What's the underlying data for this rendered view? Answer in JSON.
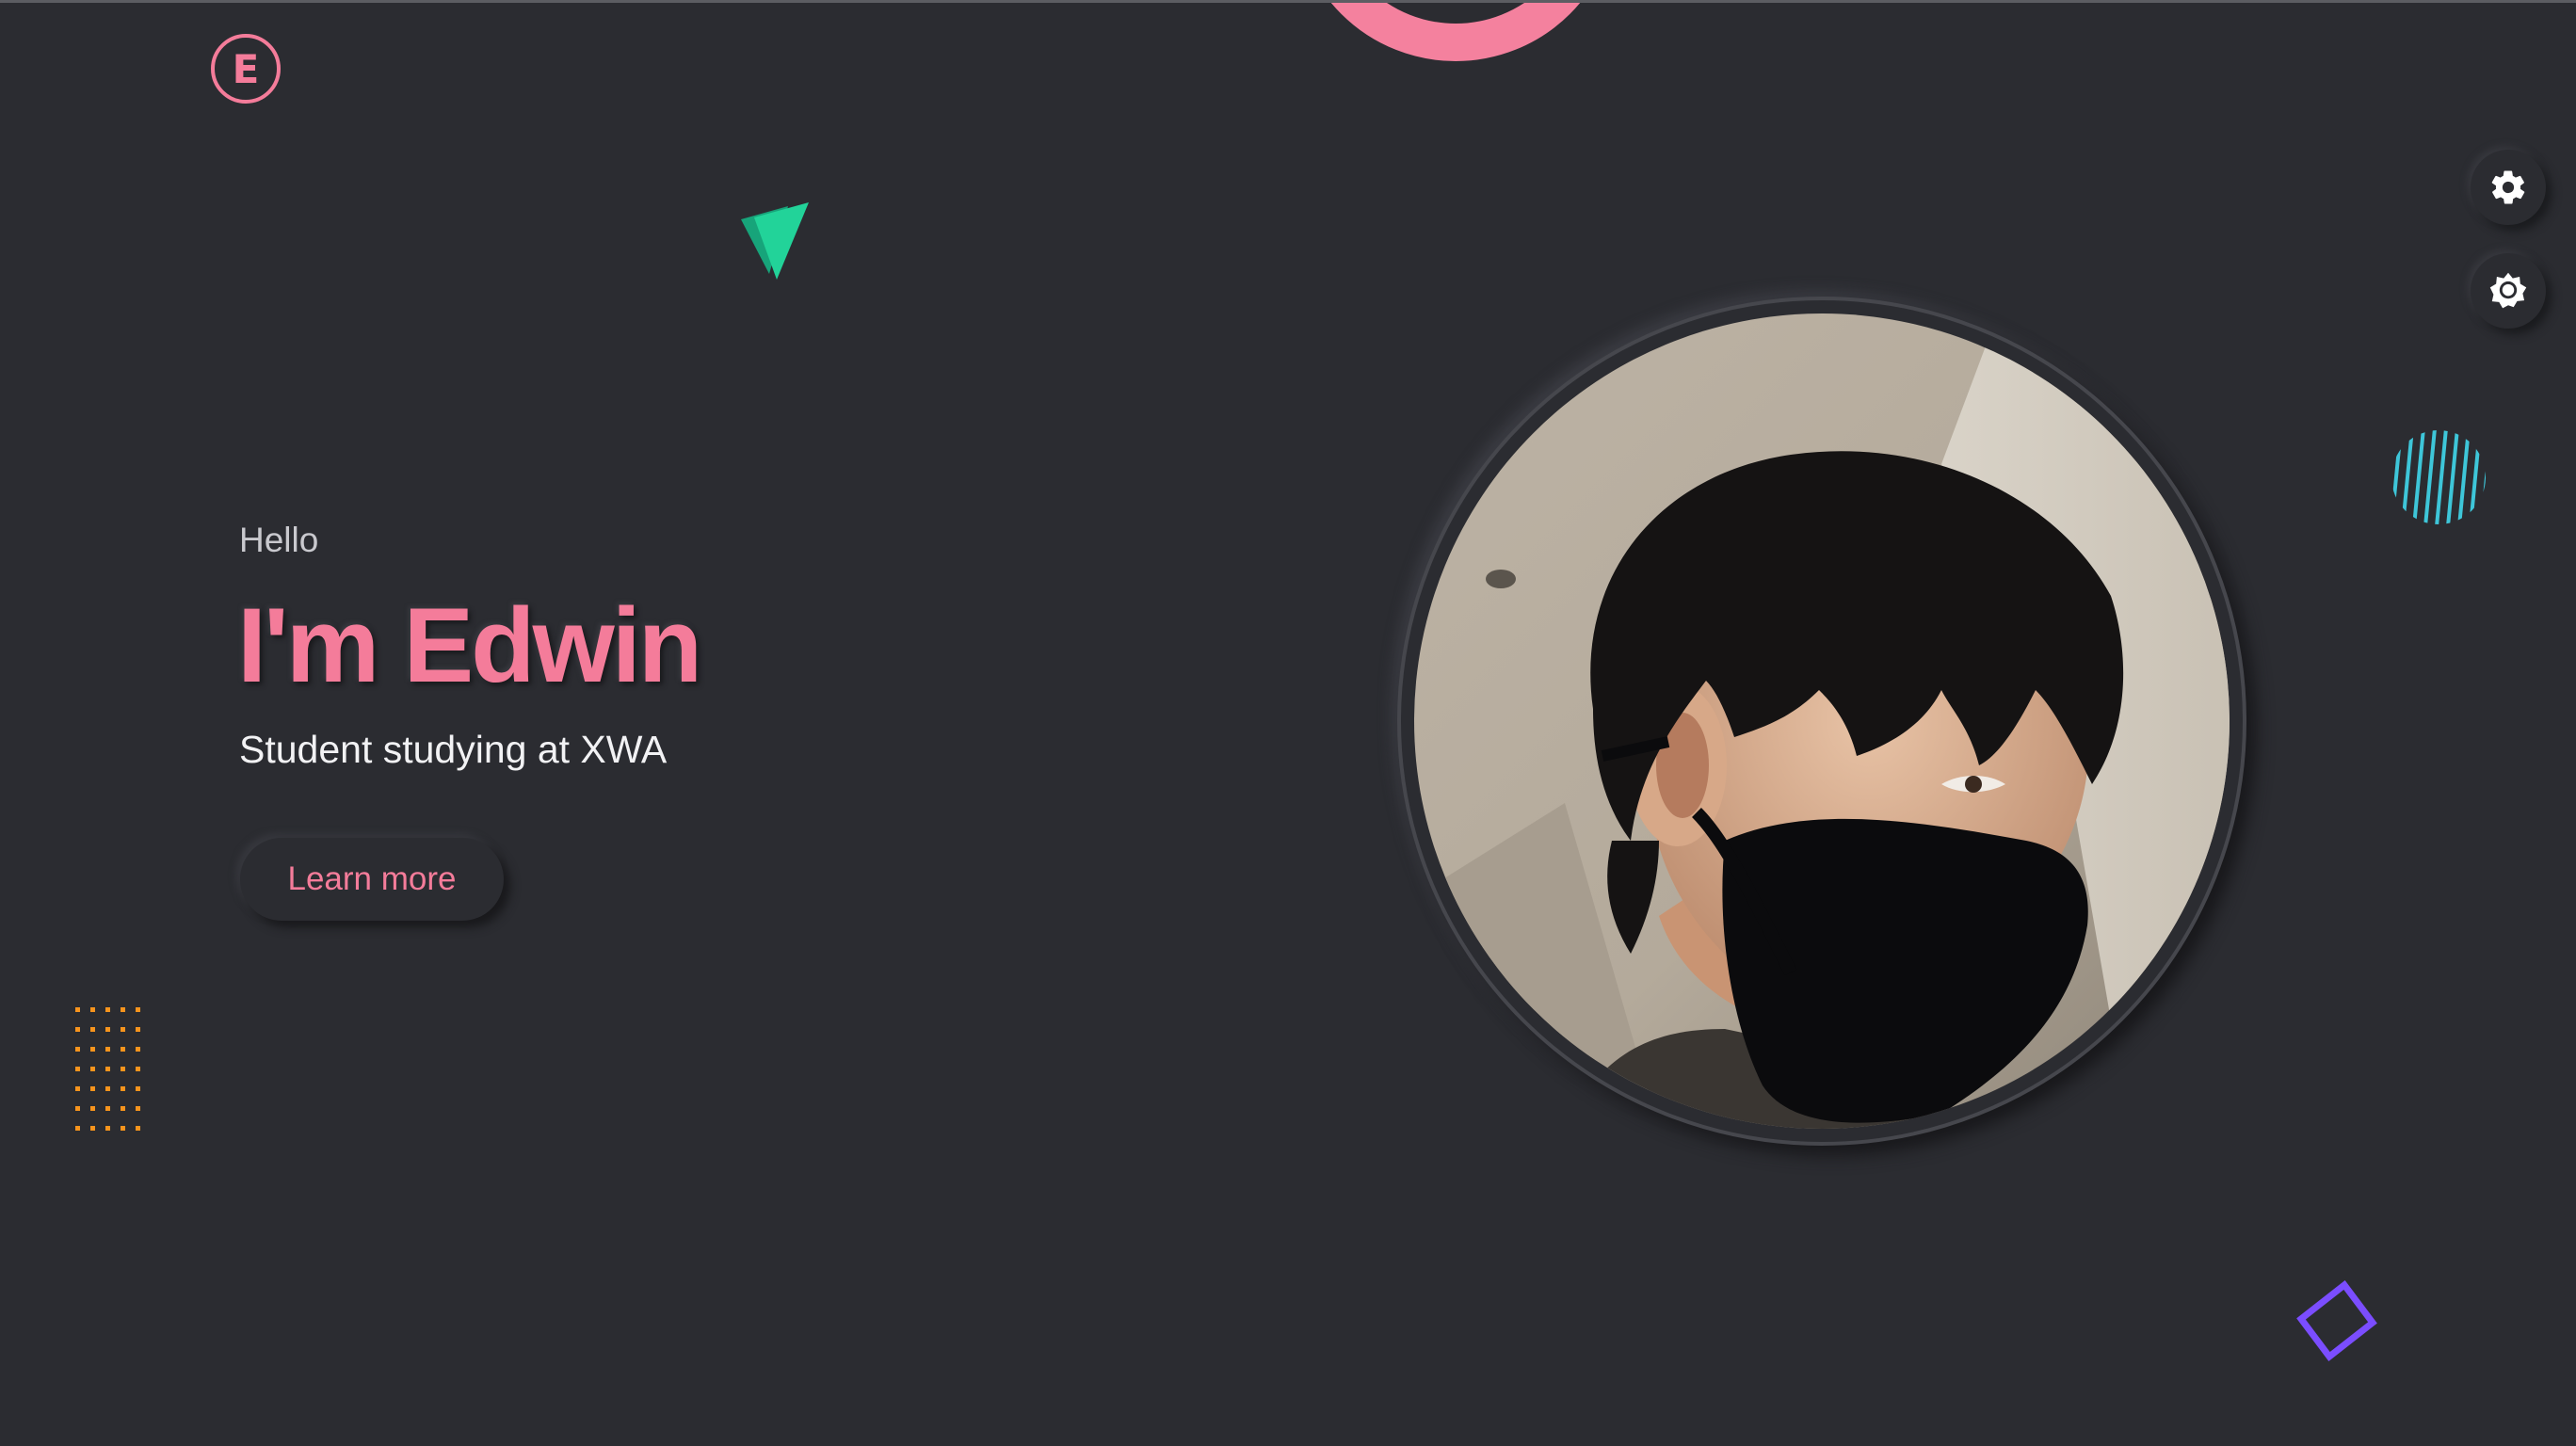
{
  "logo": {
    "letter": "E"
  },
  "hero": {
    "greeting": "Hello",
    "title": "I'm Edwin",
    "subtitle": "Student studying at XWA",
    "cta_label": "Learn more"
  },
  "controls": {
    "settings_icon": "gear-icon",
    "theme_icon": "sun-icon"
  },
  "portrait": {
    "subject": "person-photo"
  },
  "colors": {
    "background": "#2b2c31",
    "accent_pink": "#f47c9a",
    "green": "#1ccf93",
    "orange": "#f7941d",
    "cyan": "#3ec6d9",
    "purple": "#7b4dff"
  }
}
